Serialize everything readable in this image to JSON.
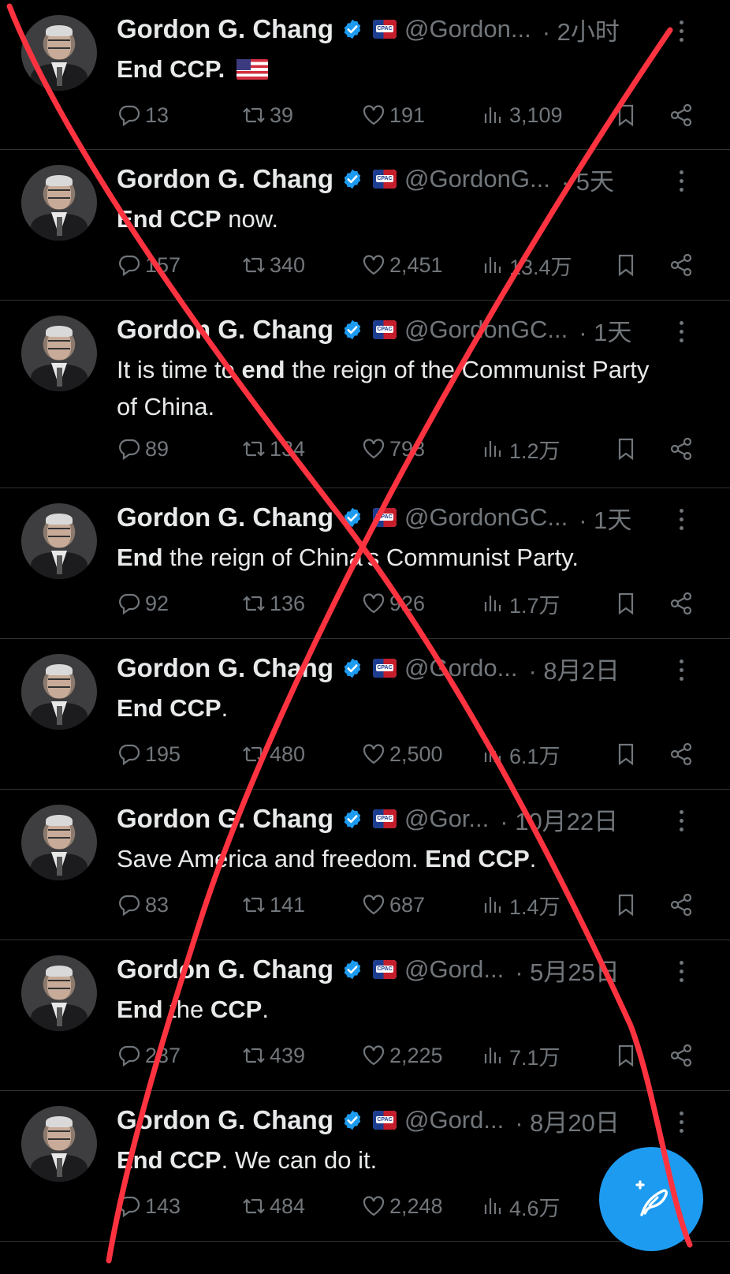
{
  "accent_color": "#1d9bf0",
  "overlay_color": "#ff3340",
  "tweets": [
    {
      "name": "Gordon G. Chang",
      "handle": "@Gordon...",
      "time": "· 2小时",
      "text": [
        {
          "t": "End CCP.",
          "b": true
        },
        {
          "t": " ",
          "b": false
        }
      ],
      "flag": true,
      "replies": "13",
      "retweets": "39",
      "likes": "191",
      "views": "3,109"
    },
    {
      "name": "Gordon G. Chang",
      "handle": "@GordonG...",
      "time": "· 5天",
      "text": [
        {
          "t": "End CCP",
          "b": true
        },
        {
          "t": " now.",
          "b": false
        }
      ],
      "replies": "157",
      "retweets": "340",
      "likes": "2,451",
      "views": "13.4万"
    },
    {
      "name": "Gordon G. Chang",
      "handle": "@GordonGC...",
      "time": "· 1天",
      "text": [
        {
          "t": "It is time to ",
          "b": false
        },
        {
          "t": "end",
          "b": true
        },
        {
          "t": " the reign of the Communist Party of China.",
          "b": false
        }
      ],
      "replies": "89",
      "retweets": "134",
      "likes": "798",
      "views": "1.2万"
    },
    {
      "name": "Gordon G. Chang",
      "handle": "@GordonGC...",
      "time": "· 1天",
      "text": [
        {
          "t": "End",
          "b": true
        },
        {
          "t": " the reign of China's Communist Party.",
          "b": false
        }
      ],
      "replies": "92",
      "retweets": "136",
      "likes": "926",
      "views": "1.7万"
    },
    {
      "name": "Gordon G. Chang",
      "handle": "@Gordo...",
      "time": "· 8月2日",
      "text": [
        {
          "t": "End CCP",
          "b": true
        },
        {
          "t": ".",
          "b": false
        }
      ],
      "replies": "195",
      "retweets": "480",
      "likes": "2,500",
      "views": "6.1万"
    },
    {
      "name": "Gordon G. Chang",
      "handle": "@Gor...",
      "time": "· 10月22日",
      "text": [
        {
          "t": "Save America and freedom. ",
          "b": false
        },
        {
          "t": "End CCP",
          "b": true
        },
        {
          "t": ".",
          "b": false
        }
      ],
      "replies": "83",
      "retweets": "141",
      "likes": "687",
      "views": "1.4万"
    },
    {
      "name": "Gordon G. Chang",
      "handle": "@Gord...",
      "time": "· 5月25日",
      "text": [
        {
          "t": "End",
          "b": true
        },
        {
          "t": " the ",
          "b": false
        },
        {
          "t": "CCP",
          "b": true
        },
        {
          "t": ".",
          "b": false
        }
      ],
      "replies": "237",
      "retweets": "439",
      "likes": "2,225",
      "views": "7.1万"
    },
    {
      "name": "Gordon G. Chang",
      "handle": "@Gord...",
      "time": "· 8月20日",
      "text": [
        {
          "t": "End CCP",
          "b": true
        },
        {
          "t": ". We can do it.",
          "b": false
        }
      ],
      "replies": "143",
      "retweets": "484",
      "likes": "2,248",
      "views": "4.6万"
    }
  ],
  "badge_text": "CPAC"
}
